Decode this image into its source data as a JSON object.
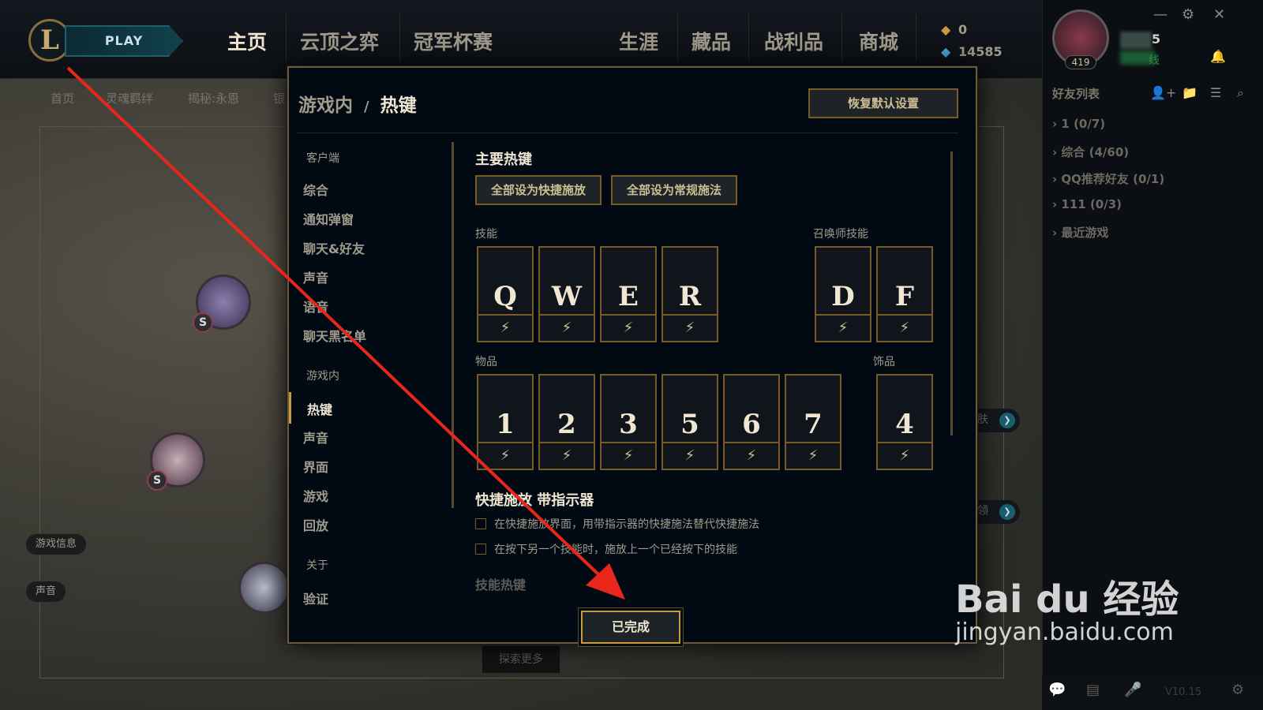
{
  "topbar": {
    "logo_letter": "L",
    "play_label": "PLAY",
    "nav_left": [
      "主页",
      "云顶之弈",
      "冠军杯赛"
    ],
    "nav_right": [
      "生涯",
      "藏品",
      "战利品",
      "商城"
    ],
    "currency": [
      {
        "icon": "orange-essence-icon",
        "value": "0"
      },
      {
        "icon": "blue-essence-icon",
        "value": "14585"
      }
    ]
  },
  "subnav": [
    "首页",
    "灵魂羁绊",
    "揭秘:永恩",
    "银"
  ],
  "background": {
    "pills": [
      "游戏信息",
      "声音"
    ],
    "explore_label": "探索更多",
    "right_stub_1": "肤",
    "right_stub_2": "领",
    "badge_letter": "S"
  },
  "social": {
    "level": "419",
    "name_fragment": "5",
    "status_fragment": "线",
    "friends_title": "好友列表",
    "groups": [
      "1 (0/7)",
      "综合 (4/60)",
      "QQ推荐好友 (0/1)",
      "111 (0/3)",
      "最近游戏"
    ],
    "version": "V10.15"
  },
  "modal": {
    "breadcrumb_parent": "游戏内",
    "breadcrumb_sep": "/",
    "breadcrumb_current": "热键",
    "reset_label": "恢复默认设置",
    "sidebar": {
      "section_client": "客户端",
      "client_items": [
        "综合",
        "通知弹窗",
        "聊天&好友",
        "声音",
        "语音",
        "聊天黑名单"
      ],
      "section_ingame": "游戏内",
      "ingame_items": [
        "热键",
        "声音",
        "界面",
        "游戏",
        "回放"
      ],
      "section_about": "关于",
      "about_items": [
        "验证"
      ]
    },
    "main_hotkeys_title": "主要热键",
    "btn_quickcast_all": "全部设为快捷施放",
    "btn_normalcast_all": "全部设为常规施法",
    "abilities_label": "技能",
    "abilities": [
      "Q",
      "W",
      "E",
      "R"
    ],
    "summoner_label": "召唤师技能",
    "summoner": [
      "D",
      "F"
    ],
    "items_label": "物品",
    "items": [
      "1",
      "2",
      "3",
      "5",
      "6",
      "7"
    ],
    "trinket_label": "饰品",
    "trinket": [
      "4"
    ],
    "quickcast_bolt": "⚡",
    "quickcast_indicator_title": "快捷施放 带指示器",
    "checkboxes": [
      "在快捷施放界面，用带指示器的快捷施法替代快捷施法",
      "在按下另一个技能时，施放上一个已经按下的技能"
    ],
    "next_section_title": "技能热键",
    "done_label": "已完成"
  },
  "watermark": {
    "brand": "Bai du 经验",
    "domain": "jingyan.baidu.com"
  },
  "colors": {
    "gold": "#c89b3c",
    "gold_dark": "#785a28",
    "text_light": "#f0e6d2",
    "text_muted": "#a09b8c",
    "modal_bg": "#010a13",
    "arrow_red": "#e8261c"
  }
}
